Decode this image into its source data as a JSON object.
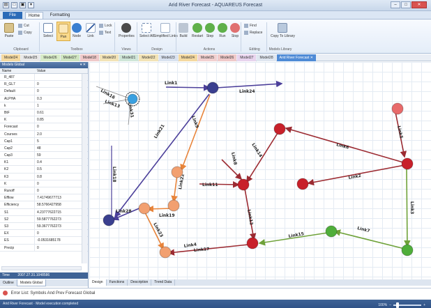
{
  "window": {
    "title": "Arid River Forecast - AQUAREUS Forecast"
  },
  "qat": [
    "▤",
    "□",
    "▣",
    "▾"
  ],
  "window_buttons": {
    "minimize": "–",
    "maximize": "□",
    "close": "✕"
  },
  "tabs": {
    "file": "File",
    "home": "Home",
    "formatting": "Formatting"
  },
  "ribbon": {
    "clipboard": {
      "paste": "Paste",
      "cut": "Cut",
      "copy": "Copy",
      "label": "Clipboard"
    },
    "toolbox": {
      "select": "Select",
      "pan": "Pan",
      "node": "Node",
      "link": "Link",
      "lock": "Lock",
      "text": "Text",
      "label": "Toolbox"
    },
    "views": {
      "properties": "Properties",
      "label": "Views"
    },
    "design": {
      "select_all": "Select All",
      "simplified_links": "Simplified Links",
      "label": "Design"
    },
    "actions": {
      "build": "Build",
      "restart": "Restart",
      "step": "Step",
      "run": "Run",
      "stop": "Stop",
      "label": "Actions"
    },
    "editing": {
      "find": "Find",
      "replace": "Replace",
      "label": "Editing"
    },
    "models_library": {
      "copy_to_library": "Copy To Library",
      "label": "Models Library"
    }
  },
  "model_tabs": [
    "Model24",
    "Model25",
    "Model26",
    "Model27",
    "Model18",
    "Model20",
    "Model21",
    "Model22",
    "Model23",
    "Model24",
    "Model25",
    "Model26",
    "Model27",
    "Model28",
    "Arid River Forecast ✕"
  ],
  "model_tab_colors": [
    "#f4d9a0",
    "#e8e8e8",
    "#d7ebc7",
    "#cfe5c1",
    "#f0c9c9",
    "#f2e3b6",
    "#cfe6d8",
    "#f2e3b6",
    "#d9e2f0",
    "#f4d9a0",
    "#f2d0d0",
    "#f0c9c9",
    "#e8d4ee",
    "#dfe6f0",
    "#4f8bd6"
  ],
  "left_panel": {
    "title": "Models Global",
    "pin": "▾ ✕",
    "col_name": "Name",
    "col_value": "Value",
    "rows": [
      {
        "name": "R_487",
        "value": ""
      },
      {
        "name": "R_GL7",
        "value": "0"
      },
      {
        "name": "Default",
        "value": "0"
      },
      {
        "name": "ALPHA",
        "value": "0.3"
      },
      {
        "name": "k",
        "value": "1"
      },
      {
        "name": "BtF",
        "value": "0.61"
      },
      {
        "name": "K",
        "value": "0.85"
      },
      {
        "name": "Forecast",
        "value": "0"
      },
      {
        "name": "Courses",
        "value": "2.0"
      },
      {
        "name": "Cap1",
        "value": "5"
      },
      {
        "name": "Cap2",
        "value": "48"
      },
      {
        "name": "Cap3",
        "value": "59"
      },
      {
        "name": "K1",
        "value": "0.4"
      },
      {
        "name": "K2",
        "value": "0.5"
      },
      {
        "name": "K3",
        "value": "0.8"
      },
      {
        "name": "K",
        "value": "0"
      },
      {
        "name": "Runoff",
        "value": "0"
      },
      {
        "name": "Efflow",
        "value": "7.41749677713"
      },
      {
        "name": "Efficiency",
        "value": "58.5766427958"
      },
      {
        "name": "S1",
        "value": "4.23777622715"
      },
      {
        "name": "S2",
        "value": "59.5877762273"
      },
      {
        "name": "S3",
        "value": "59.3677762273"
      },
      {
        "name": "EX",
        "value": "0"
      },
      {
        "name": "ES",
        "value": "-0.0531685178"
      },
      {
        "name": "Precip",
        "value": "0"
      }
    ],
    "time_label": "Time",
    "time_value": "2007.27.31.1048586",
    "tabs": [
      "Outline",
      "Models Global"
    ]
  },
  "canvas_tabs": [
    "Design",
    "Functions",
    "Description",
    "Trend Data"
  ],
  "error_text": "Error List: Symbols And Prev Forecast Global",
  "status": {
    "left": "Arid River Forecast · Model execution completed",
    "zoom": "100%"
  },
  "nodes": [
    {
      "id": "n_top",
      "color": "#3a3f8f"
    },
    {
      "id": "n_left",
      "color": "#3a3f8f"
    },
    {
      "id": "n_sel",
      "color": "#3aa0e0"
    },
    {
      "id": "n_o1",
      "color": "#f2a070"
    },
    {
      "id": "n_o2",
      "color": "#f2a070"
    },
    {
      "id": "n_o3",
      "color": "#f2a070"
    },
    {
      "id": "n_o4",
      "color": "#f2a070"
    },
    {
      "id": "n_r1",
      "color": "#c8202a"
    },
    {
      "id": "n_r2",
      "color": "#c8202a"
    },
    {
      "id": "n_r3",
      "color": "#c8202a"
    },
    {
      "id": "n_r4",
      "color": "#c8202a"
    },
    {
      "id": "n_r5",
      "color": "#c8202a"
    },
    {
      "id": "n_r6",
      "color": "#c8202a"
    },
    {
      "id": "n_pink",
      "color": "#e86a6a"
    },
    {
      "id": "n_g1",
      "color": "#4fae3a"
    },
    {
      "id": "n_g2",
      "color": "#4fae3a"
    }
  ],
  "link_labels": {
    "link16": "Link16",
    "link13": "Link13",
    "link31": "Link31",
    "link1": "Link1",
    "link24": "Link24",
    "link9": "Link9",
    "link21": "Link21",
    "link18": "Link18",
    "link22": "Link22",
    "link28": "Link28",
    "link19": "Link19",
    "link23": "Link23",
    "link17": "Link17",
    "link11": "Link11",
    "link8": "Link8",
    "link14": "Link14",
    "link12": "Link12",
    "link6": "Link6",
    "link5": "Link5",
    "link3": "Link3",
    "link2": "Link2",
    "link7": "Link7",
    "link15": "Link15",
    "link4": "Link4"
  },
  "colors": {
    "purple": "#4b3f9a",
    "orange": "#e8843a",
    "darkred": "#9c2b32",
    "green": "#6fa23a",
    "selected": "#3aa0e0"
  }
}
